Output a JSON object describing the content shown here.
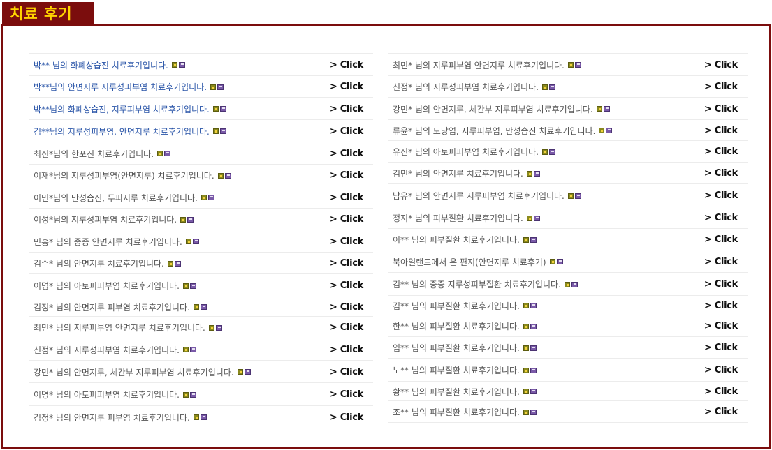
{
  "header": {
    "title": "치료 후기"
  },
  "left_items": [
    {
      "label": "박** 님의 화폐상습진 치료후기입니다.",
      "link": "> Click",
      "style": "blue"
    },
    {
      "label": "박**님의 안면지루 지루성피부염 치료후기입니다.",
      "link": "> Click",
      "style": "blue"
    },
    {
      "label": "박**님의 화폐상습진, 지루피부염 치료후기입니다.",
      "link": "> Click",
      "style": "blue"
    },
    {
      "label": "김**님의 지루성피부염, 안면지루 치료후기입니다.",
      "link": "> Click",
      "style": "blue"
    },
    {
      "label": "최진*님의 한포진 치료후기입니다.",
      "link": "> Click",
      "style": "gray"
    },
    {
      "label": "이재*님의 지루성피부염(안면지루) 치료후기입니다.",
      "link": "> Click",
      "style": "gray"
    },
    {
      "label": "이민*님의 만성습진, 두피지루 치료후기입니다.",
      "link": "> Click",
      "style": "gray"
    },
    {
      "label": "이성*님의 지루성피부염 치료후기입니다.",
      "link": "> Click",
      "style": "gray"
    },
    {
      "label": "민홍* 님의 중증 안면지루 치료후기입니다.",
      "link": "> Click",
      "style": "gray"
    },
    {
      "label": "김수* 님의 안면지루 치료후기입니다.",
      "link": "> Click",
      "style": "gray"
    },
    {
      "label": "이명* 님의 아토피피부염 치료후기입니다.",
      "link": "> Click",
      "style": "gray"
    },
    {
      "label": "김정* 님의 안면지루 피부염 치료후기입니다.",
      "link": "> Click",
      "style": "gray"
    },
    {
      "label": "최민* 님의 지루피부염 안면지루 치료후기입니다.",
      "link": "> Click",
      "style": "gray"
    },
    {
      "label": "신정* 님의 지루성피부염 치료후기입니다.",
      "link": "> Click",
      "style": "gray"
    },
    {
      "label": "강민* 님의 안면지루, 체간부 지루피부염 치료후기입니다.",
      "link": "> Click",
      "style": "gray"
    },
    {
      "label": "이명* 님의 아토피피부염 치료후기입니다.",
      "link": "> Click",
      "style": "gray"
    },
    {
      "label": "김정* 님의 안면지루 피부염 치료후기입니다.",
      "link": "> Click",
      "style": "gray"
    }
  ],
  "right_items": [
    {
      "label": "최민* 님의 지루피부염 안면지루 치료후기입니다.",
      "link": "> Click"
    },
    {
      "label": "신정* 님의 지루성피부염 치료후기입니다.",
      "link": "> Click"
    },
    {
      "label": "강민* 님의 안면지루, 체간부 지루피부염 치료후기입니다.",
      "link": "> Click"
    },
    {
      "label": "류윤* 님의 모낭염, 지루피부염, 만성습진 치료후기입니다.",
      "link": "> Click"
    },
    {
      "label": "유진* 님의 아토피피부염 치료후기입니다.",
      "link": "> Click"
    },
    {
      "label": "김민* 님의 안면지루 치료후기입니다.",
      "link": "> Click"
    },
    {
      "label": "남유* 님의 안면지루 지루피부염 치료후기입니다.",
      "link": "> Click"
    },
    {
      "label": "정지* 님의 피부질환 치료후기입니다.",
      "link": "> Click"
    },
    {
      "label": "이** 님의 피부질환 치료후기입니다.",
      "link": "> Click"
    },
    {
      "label": "북아일랜드에서 온 편지(안면지루 치료후기)",
      "link": "> Click"
    },
    {
      "label": "김** 님의 중증 지루성피부질환 치료후기입니다.",
      "link": "> Click"
    },
    {
      "label": "김** 님의 피부질환 치료후기입니다.",
      "link": "> Click"
    },
    {
      "label": "한** 님의 피부질환 치료후기입니다.",
      "link": "> Click"
    },
    {
      "label": "임** 님의 피부질환 치료후기입니다.",
      "link": "> Click"
    },
    {
      "label": "노** 님의 피부질환 치료후기입니다.",
      "link": "> Click"
    },
    {
      "label": "황** 님의 피부질환 치료후기입니다.",
      "link": "> Click"
    },
    {
      "label": "조** 님의 피부질환 치료후기입니다.",
      "link": "> Click"
    }
  ],
  "icons": {
    "first": "attachment-image-icon",
    "second": "save-disk-icon"
  },
  "colors": {
    "header_bg": "#7b0d0d",
    "header_text": "#ffd400",
    "link_blue": "#2a55a8",
    "border": "#7b0d0d"
  }
}
